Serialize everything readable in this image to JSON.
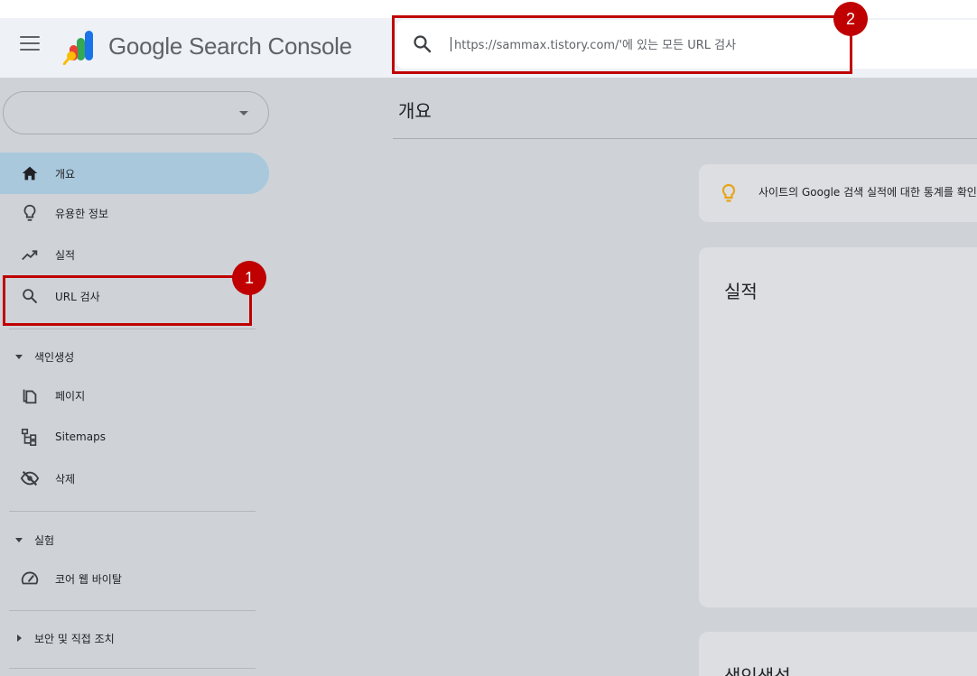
{
  "header": {
    "brand": "Google Search Console",
    "search_placeholder": "https://sammax.tistory.com/'에 있는 모든 URL 검사"
  },
  "sidebar": {
    "property_value": "",
    "items": [
      {
        "label": "개요",
        "icon": "home-icon",
        "active": true
      },
      {
        "label": "유용한 정보",
        "icon": "lightbulb-icon"
      },
      {
        "label": "실적",
        "icon": "trending-up-icon"
      },
      {
        "label": "URL 검사",
        "icon": "search-icon"
      }
    ],
    "sections": [
      {
        "label": "색인생성",
        "expanded": true,
        "items": [
          {
            "label": "페이지",
            "icon": "pages-icon"
          },
          {
            "label": "Sitemaps",
            "icon": "sitemap-icon"
          },
          {
            "label": "삭제",
            "icon": "eye-off-icon"
          }
        ]
      },
      {
        "label": "실험",
        "expanded": true,
        "items": [
          {
            "label": "코어 웹 바이탈",
            "icon": "speed-gauge-icon"
          }
        ]
      },
      {
        "label": "보안 및 직접 조치",
        "expanded": false,
        "items": []
      }
    ]
  },
  "main": {
    "page_title": "개요",
    "tip_text": "사이트의 Google 검색 실적에 대한 통계를 확인하",
    "performance_title": "실적",
    "index_title": "색인생성"
  },
  "annotations": [
    {
      "number": "1"
    },
    {
      "number": "2"
    }
  ],
  "colors": {
    "annotation": "#c00000",
    "active_nav": "#a9c8dc",
    "tip_icon": "#e8a317",
    "background": "#cfd3d8"
  }
}
